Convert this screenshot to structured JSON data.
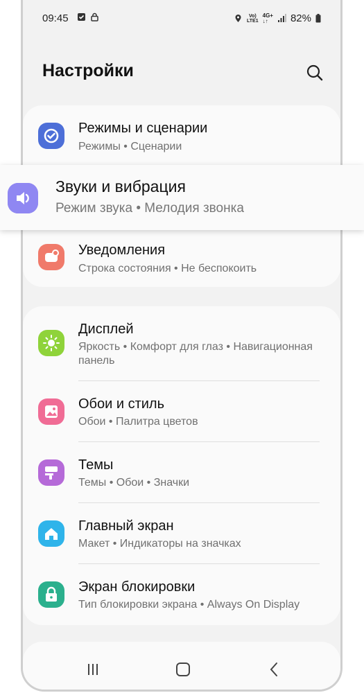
{
  "status_bar": {
    "time": "09:45",
    "battery": "82%",
    "net_label_top": "Vo)",
    "net_label_bottom": "LTE1",
    "net2_top": "4G+"
  },
  "header": {
    "title": "Настройки"
  },
  "highlighted_item": {
    "title": "Звуки и вибрация",
    "subtitle": "Режим звука  •  Мелодия звонка",
    "icon": "volume-icon",
    "color": "#8f87f2"
  },
  "group1": [
    {
      "title": "Режимы и сценарии",
      "subtitle": "Режимы  •  Сценарии",
      "icon": "modes-icon",
      "color": "#4d6fd8"
    },
    {
      "title": "Уведомления",
      "subtitle": "Строка состояния  •  Не беспокоить",
      "icon": "notifications-icon",
      "color": "#f07a6a"
    }
  ],
  "group2": [
    {
      "title": "Дисплей",
      "subtitle": "Яркость  •  Комфорт для глаз  •  Навигационная панель",
      "icon": "brightness-icon",
      "color": "#8fd33a"
    },
    {
      "title": "Обои и стиль",
      "subtitle": "Обои  •  Палитра цветов",
      "icon": "wallpaper-icon",
      "color": "#f06c95"
    },
    {
      "title": "Темы",
      "subtitle": "Темы  •  Обои  •  Значки",
      "icon": "themes-icon",
      "color": "#b56ad8"
    },
    {
      "title": "Главный экран",
      "subtitle": "Макет  •  Индикаторы на значках",
      "icon": "home-icon",
      "color": "#2fb4ea"
    },
    {
      "title": "Экран блокировки",
      "subtitle": "Тип блокировки экрана  •  Always On Display",
      "icon": "lock-icon",
      "color": "#2bb08d"
    }
  ],
  "navigation": {
    "recent": "recents-icon",
    "home": "home-button-icon",
    "back": "back-icon"
  }
}
